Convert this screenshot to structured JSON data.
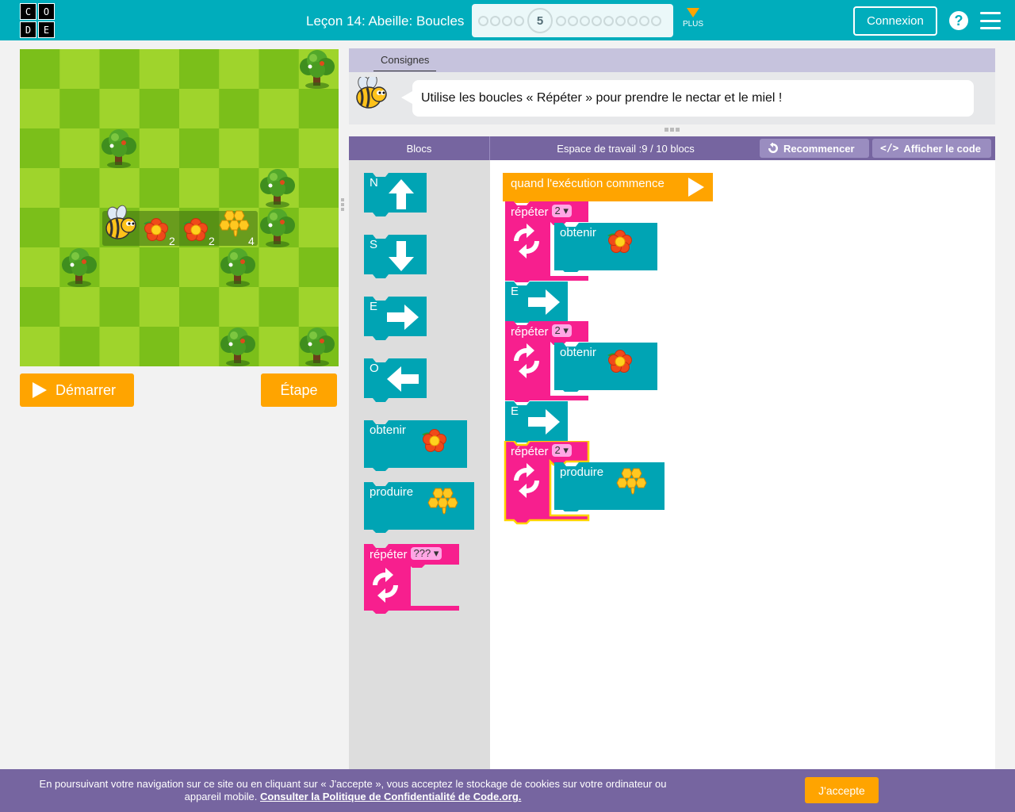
{
  "header": {
    "logo_letters": [
      "C",
      "O",
      "D",
      "E"
    ],
    "lesson_title": "Leçon 14: Abeille: Boucles",
    "progress": {
      "current_level": "5",
      "total_levels": 15
    },
    "plus_label": "PLUS",
    "login_label": "Connexion",
    "help_icon": "?",
    "menu_icon": "hamburger-menu-icon"
  },
  "maze": {
    "grid_rows": 8,
    "grid_cols": 8,
    "colors": {
      "light": "#9fd42c",
      "dark": "#7bbf1a"
    },
    "counts": [
      "2",
      "2",
      "4"
    ]
  },
  "controls": {
    "run_label": "Démarrer",
    "step_label": "Étape"
  },
  "instructions": {
    "tab_label": "Consignes",
    "text": "Utilise les boucles « Répéter » pour prendre le nectar et le miel !"
  },
  "toolbar": {
    "blocks_label": "Blocs",
    "workspace_label": "Espace de travail :9 / 10 blocs",
    "reset_label": "Recommencer",
    "show_code_label": "Afficher le code"
  },
  "toolbox": {
    "north": "N",
    "south": "S",
    "east": "E",
    "west": "O",
    "get": "obtenir",
    "make": "produire",
    "repeat": "répéter",
    "repeat_value": "???"
  },
  "workspace": {
    "when_run": "quand l'exécution commence",
    "repeat_label": "répéter",
    "repeat_count": "2",
    "get_label": "obtenir",
    "make_label": "produire",
    "east_label": "E"
  },
  "colors": {
    "teal": "#00adbc",
    "orange": "#ffa400",
    "pink": "#f71f8e",
    "block_teal": "#00a4b4",
    "purple": "#7665a0"
  },
  "cookie": {
    "text": "En poursuivant votre navigation sur ce site ou en cliquant sur « J'accepte », vous acceptez le stockage de cookies sur votre ordinateur ou appareil mobile.",
    "link": "Consulter la Politique de Confidentialité de Code.org.",
    "accept_label": "J'accepte"
  }
}
